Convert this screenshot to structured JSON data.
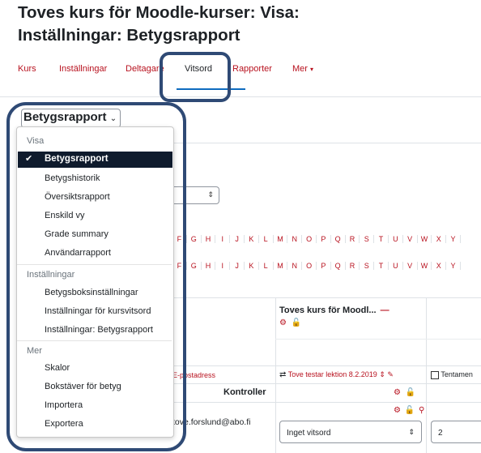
{
  "page": {
    "title_line1": "Toves kurs för Moodle-kurser: Visa:",
    "title_line2": "Inställningar: Betygsrapport"
  },
  "nav": {
    "tabs": [
      {
        "label": "Kurs"
      },
      {
        "label": "Inställningar"
      },
      {
        "label": "Deltagare"
      },
      {
        "label": "Vitsord",
        "active": true
      },
      {
        "label": "Rapporter"
      },
      {
        "label": "Mer"
      }
    ]
  },
  "report_select": {
    "label": "Betygsrapport"
  },
  "dropdown": {
    "groups": [
      {
        "header": "Visa",
        "items": [
          "Betygsrapport",
          "Betygshistorik",
          "Översiktsrapport",
          "Enskild vy",
          "Grade summary",
          "Användarrapport"
        ]
      },
      {
        "header": "Inställningar",
        "items": [
          "Betygsboksinställningar",
          "Inställningar för kursvitsord",
          "Inställningar: Betygsrapport"
        ]
      },
      {
        "header": "Mer",
        "items": [
          "Skalor",
          "Bokstäver för betyg",
          "Importera",
          "Exportera"
        ]
      }
    ],
    "selected": "Betygsrapport"
  },
  "letters": [
    "F",
    "G",
    "H",
    "I",
    "J",
    "K",
    "L",
    "M",
    "N",
    "O",
    "P",
    "Q",
    "R",
    "S",
    "T",
    "U",
    "V",
    "W",
    "X",
    "Y"
  ],
  "grader": {
    "course_header": "Toves kurs för Moodl...",
    "email_header": "E-postadress",
    "item_header": "Tove testar lektion 8.2.2019",
    "exam_header": "Tentamen",
    "controls_label": "Kontroller",
    "user_email": "tove.forslund@abo.fi",
    "grade_select": "Inget vitsord",
    "grade_value": "2"
  },
  "colors": {
    "link_red": "#b8121f",
    "selected_bg": "#0f1b2d",
    "highlight_border": "#2f4a75"
  }
}
